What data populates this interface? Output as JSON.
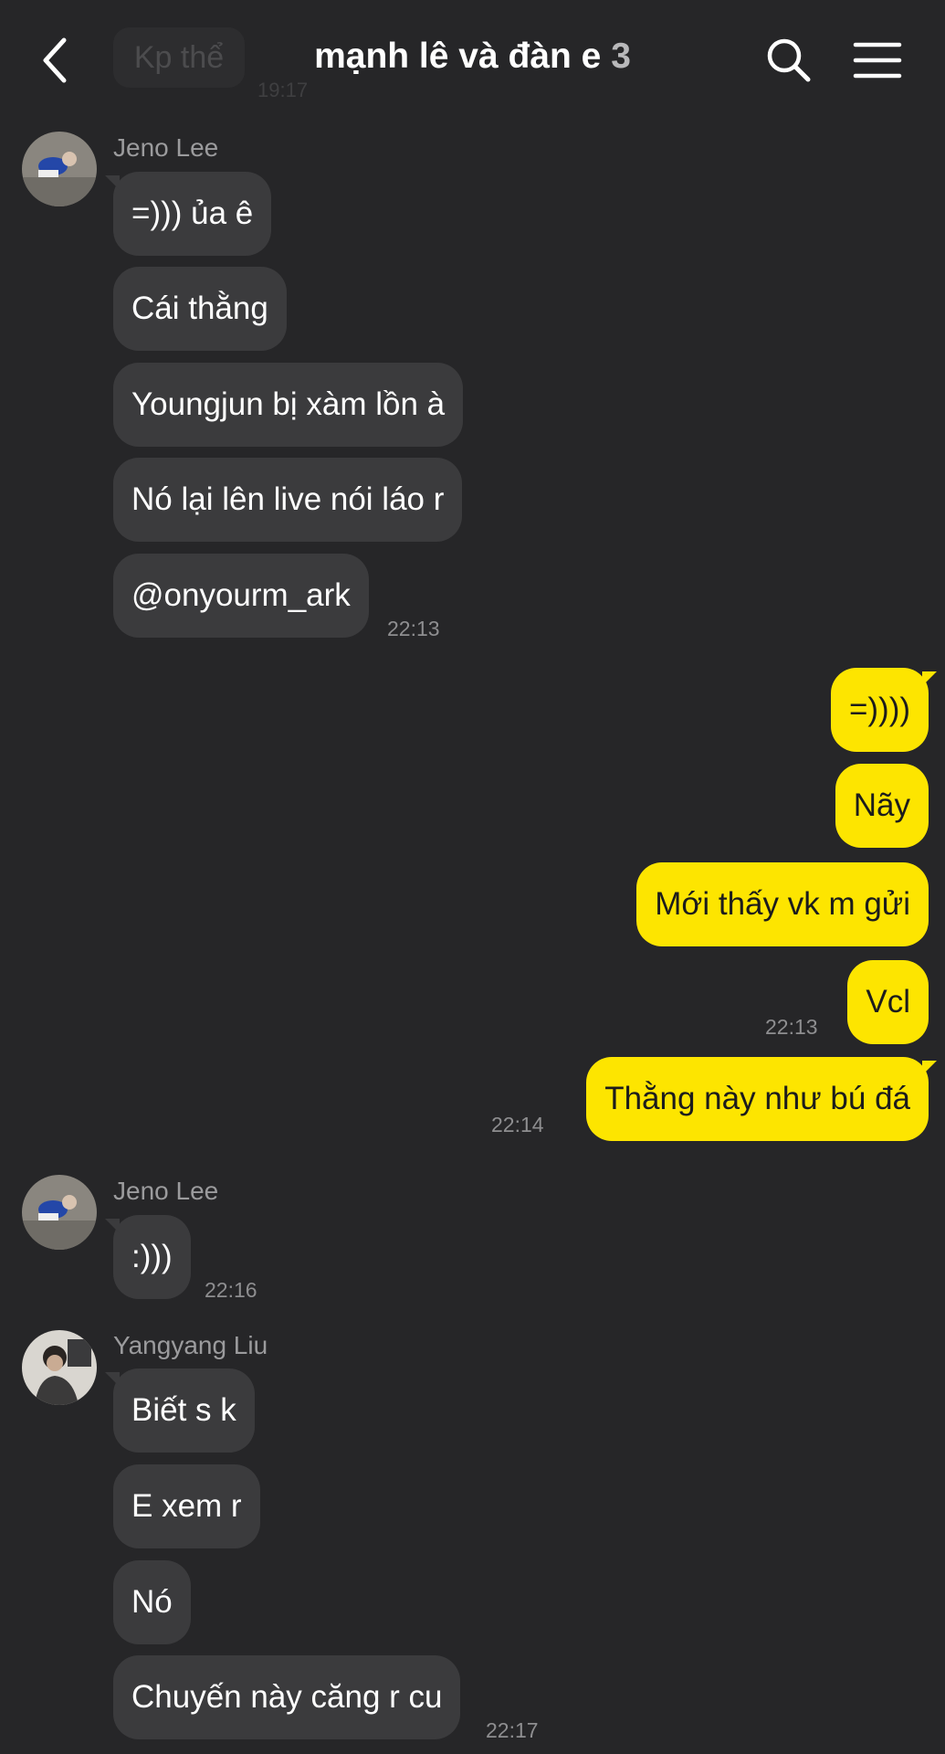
{
  "header": {
    "title": "mạnh lê và đàn e",
    "member_count": "3",
    "ghost_message": "Kp thể",
    "ghost_time": "19:17"
  },
  "colors": {
    "background": "#262628",
    "incoming_bubble": "#3b3b3d",
    "outgoing_bubble": "#fde500"
  },
  "icons": [
    "back-arrow-icon",
    "search-icon",
    "hamburger-menu-icon"
  ],
  "messages": {
    "group1": {
      "sender": "Jeno Lee",
      "lines": [
        "=))) ủa ê",
        "Cái thằng",
        "Youngjun bị xàm lồn à",
        "Nó lại lên live nói láo r",
        "@onyourm_ark"
      ],
      "time": "22:13"
    },
    "mine1": {
      "lines": [
        "=))))",
        "Nãy",
        "Mới thấy vk m gửi",
        "Vcl"
      ],
      "time": "22:13"
    },
    "mine2": {
      "lines": [
        "Thằng này như bú đá"
      ],
      "time": "22:14"
    },
    "group2": {
      "sender": "Jeno Lee",
      "lines": [
        ":)))"
      ],
      "time": "22:16"
    },
    "group3": {
      "sender": "Yangyang Liu",
      "lines": [
        "Biết s k",
        "E xem r",
        "Nó",
        "Chuyến này căng r cu"
      ],
      "time": "22:17"
    }
  }
}
